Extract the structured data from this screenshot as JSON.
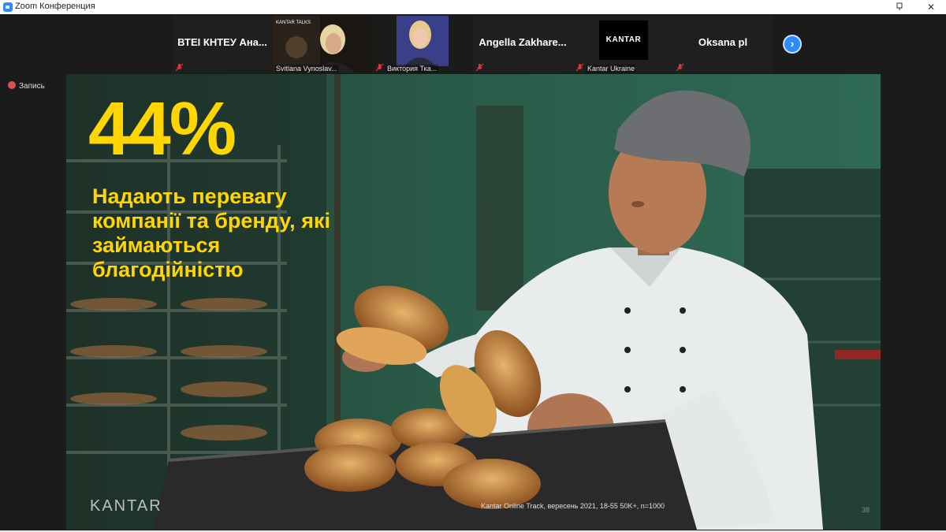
{
  "window": {
    "title": "Zoom Конференция",
    "pin_icon": "pin-icon",
    "close_icon": "close-icon"
  },
  "participants": [
    {
      "name": "ВТЕІ КНТЕУ Ана...",
      "type": "name",
      "muted": true
    },
    {
      "name": "Svitlana Vynoslav...",
      "type": "video",
      "muted": false,
      "caption_top": "KANTAR TALKS"
    },
    {
      "name": "Виктория Тка...",
      "type": "video",
      "muted": true
    },
    {
      "name": "Angella  Zakhare...",
      "type": "name",
      "muted": true
    },
    {
      "name": "Kantar Ukraine",
      "type": "logo",
      "logo_text": "KANTAR",
      "muted": true
    },
    {
      "name": "Oksana pl",
      "type": "name",
      "muted": true
    }
  ],
  "strip": {
    "next_icon": "chevron-right-icon"
  },
  "recording": {
    "label": "Запись",
    "icon": "record-dot-icon",
    "color": "#d9534f"
  },
  "slide": {
    "headline": "44%",
    "subtext": "Надають перевагу компанії та бренду, які займаються благодійністю",
    "brand": "KANTAR",
    "source": "Kantar Online Track, вересень 2021, 18-55 50K+, n=1000",
    "page": "38",
    "accent_color": "#ffd600"
  }
}
